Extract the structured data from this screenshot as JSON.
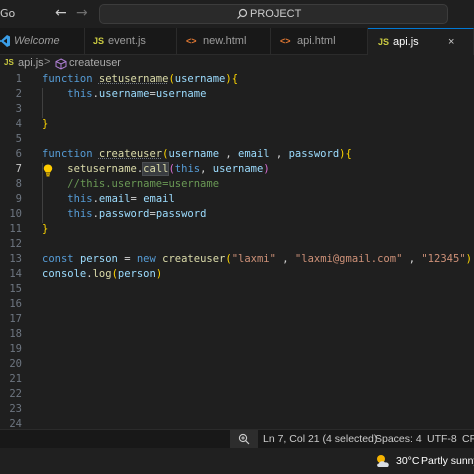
{
  "titlebar": {
    "menu_go": "Go",
    "search_label": "PROJECT"
  },
  "tabs": [
    {
      "icon": "vscode-logo-icon",
      "label": "Welcome"
    },
    {
      "icon": "JS",
      "label": "event.js"
    },
    {
      "icon": "<>",
      "label": "new.html"
    },
    {
      "icon": "<>",
      "label": "api.html"
    },
    {
      "icon": "JS",
      "label": "api.js",
      "active": true
    }
  ],
  "breadcrumb": {
    "file_icon": "JS",
    "file": "api.js",
    "separator": ">",
    "symbol_icon": "cube-method-icon",
    "symbol": "createuser"
  },
  "editor": {
    "current_line": 7,
    "line_numbers": [
      "1",
      "2",
      "3",
      "4",
      "5",
      "6",
      "7",
      "8",
      "9",
      "10",
      "11",
      "12",
      "13",
      "14",
      "15",
      "16",
      "17",
      "18",
      "19",
      "20",
      "21",
      "22",
      "23",
      "24"
    ],
    "tokens": {
      "function": "function",
      "setusername": "setusername",
      "createuser": "createuser",
      "this": "this",
      "username": "username",
      "email": "email",
      "password": "password",
      "call": "call",
      "const": "const",
      "person": "person",
      "new": "new",
      "console": "console",
      "log": "log",
      "str_laxmi": "\"laxmi\"",
      "str_email": "\"laxmi@gmail.com\"",
      "str_pass": "\"12345\"",
      "comment": "//this.username=username"
    }
  },
  "statusbar": {
    "position": "Ln 7, Col 21 (4 selected)",
    "spaces": "Spaces: 4",
    "encoding": "UTF-8",
    "eol": "CF"
  },
  "taskbar": {
    "temperature": "30°C",
    "weather": "Partly sunny"
  },
  "colors": {
    "keyword": "#569cd6",
    "function": "#dcdcaa",
    "variable": "#9cdcfe",
    "string": "#ce9178",
    "comment": "#6a9955",
    "bracket": "#ffd700",
    "accent": "#0078d4"
  }
}
